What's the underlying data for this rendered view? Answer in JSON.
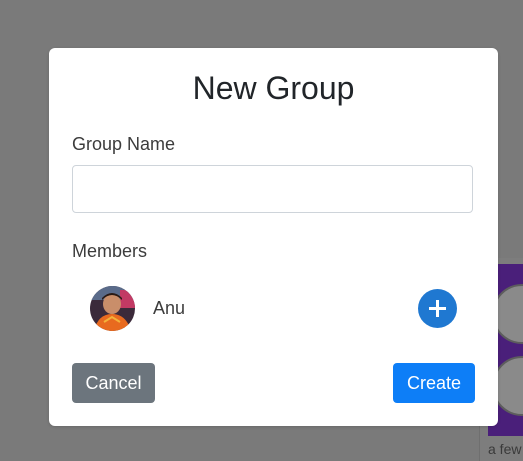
{
  "modal": {
    "title": "New Group",
    "group_name_label": "Group Name",
    "group_name_value": "",
    "group_name_placeholder": "",
    "members_label": "Members",
    "members": [
      {
        "name": "Anu",
        "avatar": "avatar-photo"
      }
    ],
    "add_member_icon": "plus-icon",
    "cancel_label": "Cancel",
    "create_label": "Create"
  },
  "background": {
    "card_caption": "a few"
  },
  "colors": {
    "backdrop": "#7a7a7a",
    "primary": "#0d7ef7",
    "add_button": "#1f78d1",
    "secondary": "#6c757d"
  }
}
